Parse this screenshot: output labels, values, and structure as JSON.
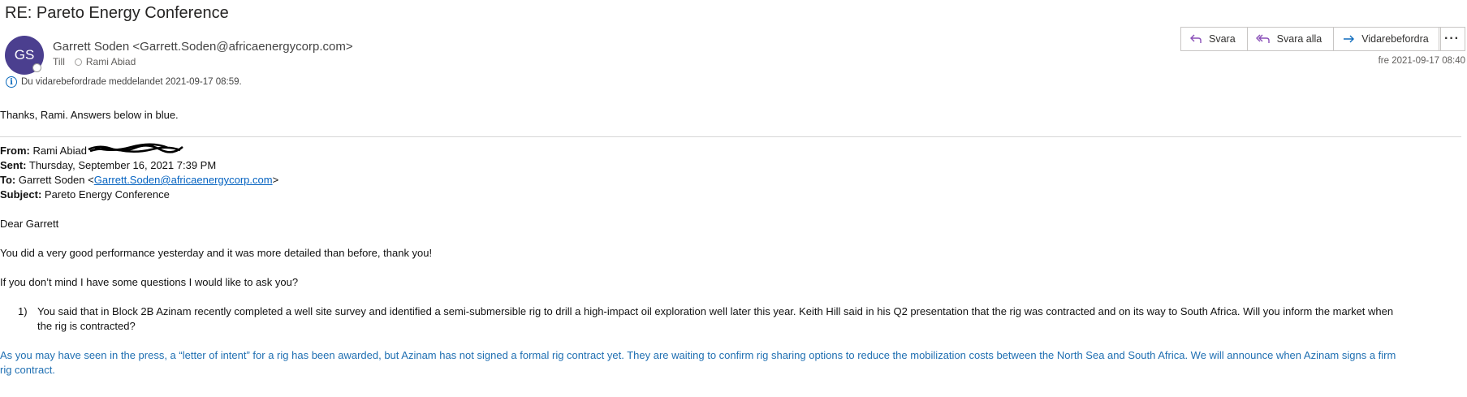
{
  "email": {
    "subject": "RE: Pareto Energy Conference",
    "sender_initials": "GS",
    "sender": "Garrett Soden <Garrett.Soden@africaenergycorp.com>",
    "to_label": "Till",
    "to_name": "Rami Abiad",
    "forward_info": "Du vidarebefordrade meddelandet 2021-09-17 08:59.",
    "date": "fre 2021-09-17 08:40"
  },
  "actions": {
    "reply": "Svara",
    "reply_all": "Svara alla",
    "forward": "Vidarebefordra",
    "more": "···"
  },
  "body": {
    "greeting": "Thanks, Rami.  Answers below in blue.",
    "from_label": "From:",
    "from_value": " Rami Abiad ",
    "sent_label": "Sent:",
    "sent_value": " Thursday, September 16, 2021 7:39 PM",
    "to_label": "To:",
    "to_name": " Garrett Soden <",
    "to_email": "Garrett.Soden@africaenergycorp.com",
    "to_close": ">",
    "subject_label": "Subject:",
    "subject_value": " Pareto Energy Conference",
    "dear": "Dear Garrett",
    "para1": "You did a very good performance yesterday and it was more detailed than before, thank you!",
    "para2": "If you don’t mind I have some questions I would like to ask you?",
    "q1_num": "1)",
    "q1_line1": "You said that in Block 2B Azinam recently completed a well site survey and identified a semi-submersible rig to drill a high-impact oil exploration well later this year. Keith Hill said in his Q2 presentation that the rig was contracted and on its way to South Africa. Will you inform the market when",
    "q1_line2": "the rig is contracted?",
    "answer_line1": "As you may have seen in the press, a “letter of intent” for a rig has been awarded, but Azinam has not signed a formal rig contract yet.  They are waiting to confirm rig sharing options to reduce the mobilization costs between the North Sea and South Africa.  We will announce when Azinam signs a firm",
    "answer_line2": "rig contract."
  }
}
